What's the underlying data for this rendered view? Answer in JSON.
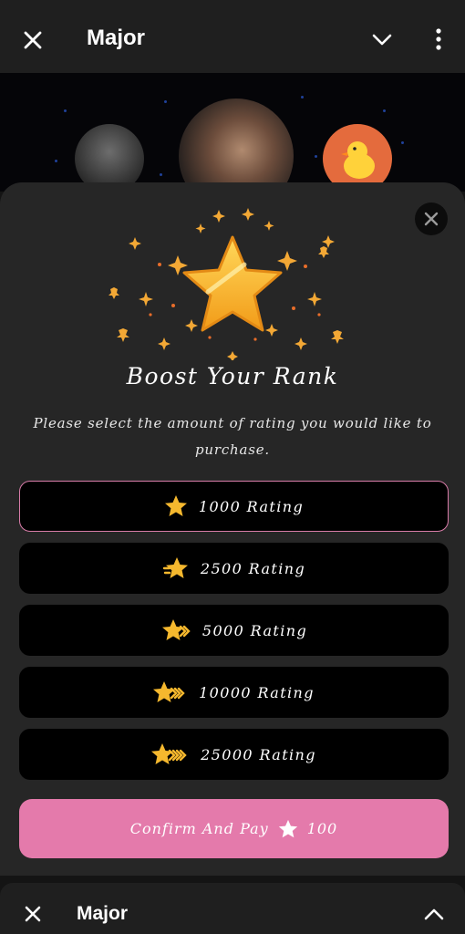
{
  "top_bar": {
    "title": "Major",
    "close_icon": "close-icon",
    "dropdown_icon": "chevron-down-icon",
    "menu_icon": "more-vertical-icon"
  },
  "modal": {
    "close_icon": "close-icon",
    "hero_icon": "star-icon",
    "heading": "Boost Your Rank",
    "subtitle": "Please select the amount of rating you would like to purchase.",
    "options": [
      {
        "label": "1000 Rating",
        "selected": true
      },
      {
        "label": "2500 Rating",
        "selected": false
      },
      {
        "label": "5000 Rating",
        "selected": false
      },
      {
        "label": "10000 Rating",
        "selected": false
      },
      {
        "label": "25000 Rating",
        "selected": false
      }
    ],
    "confirm": {
      "label": "Confirm And Pay",
      "amount": "100",
      "icon": "star-icon"
    }
  },
  "bottom_bar": {
    "title": "Major",
    "close_icon": "close-icon",
    "expand_icon": "chevron-up-icon"
  },
  "colors": {
    "accent_pink": "#e47aab",
    "selected_border": "#d87ca8",
    "star_gold": "#f5b82e",
    "background": "#262626"
  }
}
